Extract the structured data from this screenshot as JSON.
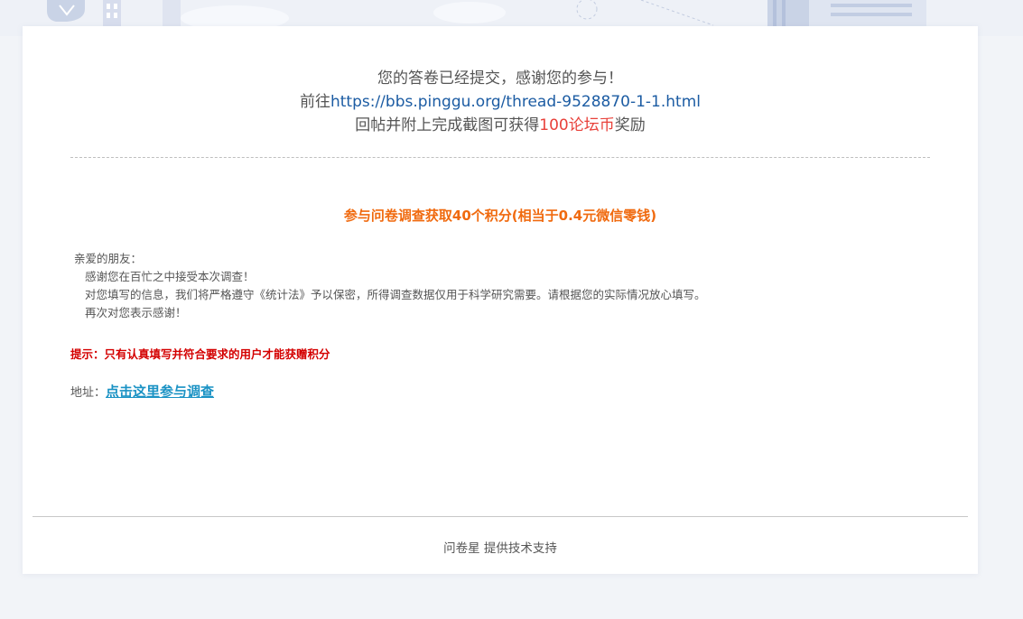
{
  "header": {
    "line1": "您的答卷已经提交，感谢您的参与！",
    "line2_prefix": "前往",
    "line2_link": "https://bbs.pinggu.org/thread-9528870-1-1.html",
    "line3_prefix": "回帖并附上完成截图可获得",
    "line3_highlight": "100论坛币",
    "line3_suffix": "奖励"
  },
  "headline": "参与问卷调查获取40个积分(相当于0.4元微信零钱)",
  "letter": {
    "greeting": "亲爱的朋友：",
    "lines": [
      "感谢您在百忙之中接受本次调查！",
      "对您填写的信息，我们将严格遵守《统计法》予以保密，所得调查数据仅用于科学研究需要。请根据您的实际情况放心填写。",
      "再次对您表示感谢！"
    ]
  },
  "hint": "提示：只有认真填写并符合要求的用户才能获赠积分",
  "address": {
    "label": "地址：",
    "link_text": "点击这里参与调查"
  },
  "footer": "问卷星 提供技术支持",
  "colors": {
    "link_blue": "#1c5ca3",
    "reward_red": "#e8413a",
    "headline_orange": "#f06a0f",
    "hint_red": "#d40000",
    "survey_link": "#1a92c4"
  }
}
